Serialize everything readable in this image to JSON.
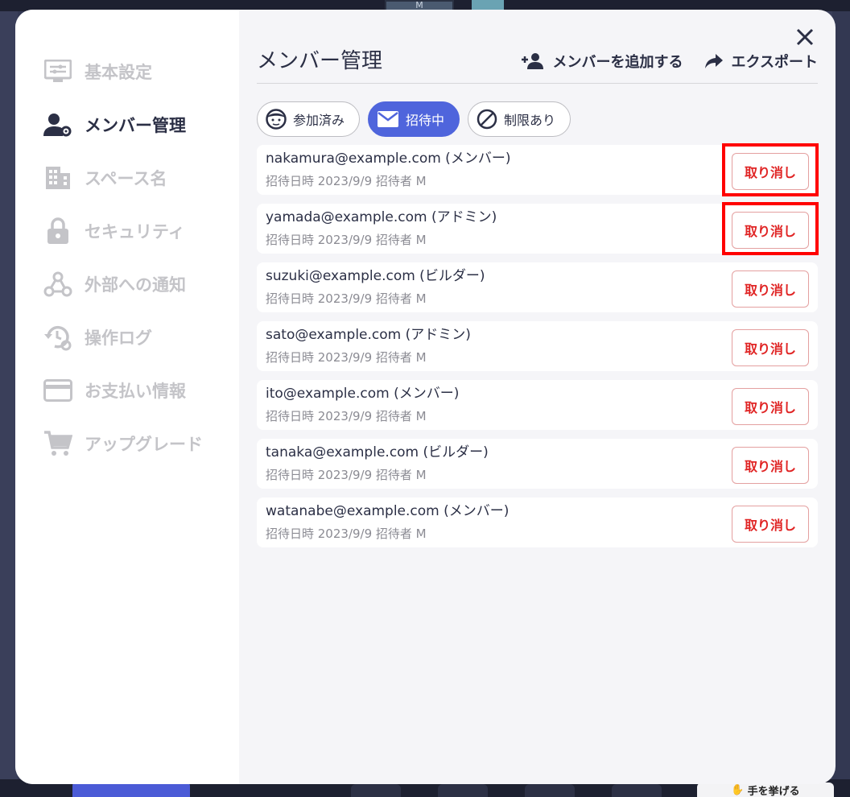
{
  "background": {
    "top_tile_text": "M",
    "raise_hand_label": "手を挙げる"
  },
  "sidebar": {
    "items": [
      {
        "label": "基本設定",
        "icon": "settings-panel-icon",
        "active": false
      },
      {
        "label": "メンバー管理",
        "icon": "user-gear-icon",
        "active": true
      },
      {
        "label": "スペース名",
        "icon": "building-icon",
        "active": false
      },
      {
        "label": "セキュリティ",
        "icon": "lock-icon",
        "active": false
      },
      {
        "label": "外部への通知",
        "icon": "webhook-icon",
        "active": false
      },
      {
        "label": "操作ログ",
        "icon": "history-gear-icon",
        "active": false
      },
      {
        "label": "お支払い情報",
        "icon": "credit-card-icon",
        "active": false
      },
      {
        "label": "アップグレード",
        "icon": "cart-icon",
        "active": false
      }
    ]
  },
  "header": {
    "title": "メンバー管理",
    "add_member_label": "メンバーを追加する",
    "export_label": "エクスポート"
  },
  "filters": {
    "joined": "参加済み",
    "invited": "招待中",
    "restricted": "制限あり"
  },
  "invites": [
    {
      "email": "nakamura@example.com (メンバー)",
      "meta": "招待日時 2023/9/9 招待者 M",
      "action": "取り消し",
      "highlighted": true
    },
    {
      "email": "yamada@example.com (アドミン)",
      "meta": "招待日時 2023/9/9 招待者 M",
      "action": "取り消し",
      "highlighted": true
    },
    {
      "email": "suzuki@example.com (ビルダー)",
      "meta": "招待日時 2023/9/9 招待者 M",
      "action": "取り消し",
      "highlighted": false
    },
    {
      "email": "sato@example.com (アドミン)",
      "meta": "招待日時 2023/9/9 招待者 M",
      "action": "取り消し",
      "highlighted": false
    },
    {
      "email": "ito@example.com (メンバー)",
      "meta": "招待日時 2023/9/9 招待者 M",
      "action": "取り消し",
      "highlighted": false
    },
    {
      "email": "tanaka@example.com (ビルダー)",
      "meta": "招待日時 2023/9/9 招待者 M",
      "action": "取り消し",
      "highlighted": false
    },
    {
      "email": "watanabe@example.com (メンバー)",
      "meta": "招待日時 2023/9/9 招待者 M",
      "action": "取り消し",
      "highlighted": false
    }
  ],
  "colors": {
    "accent": "#4f65dc",
    "danger": "#e02424",
    "highlight": "#ff0000",
    "text_dark": "#2b2f45",
    "text_muted": "#c4c4c8"
  }
}
